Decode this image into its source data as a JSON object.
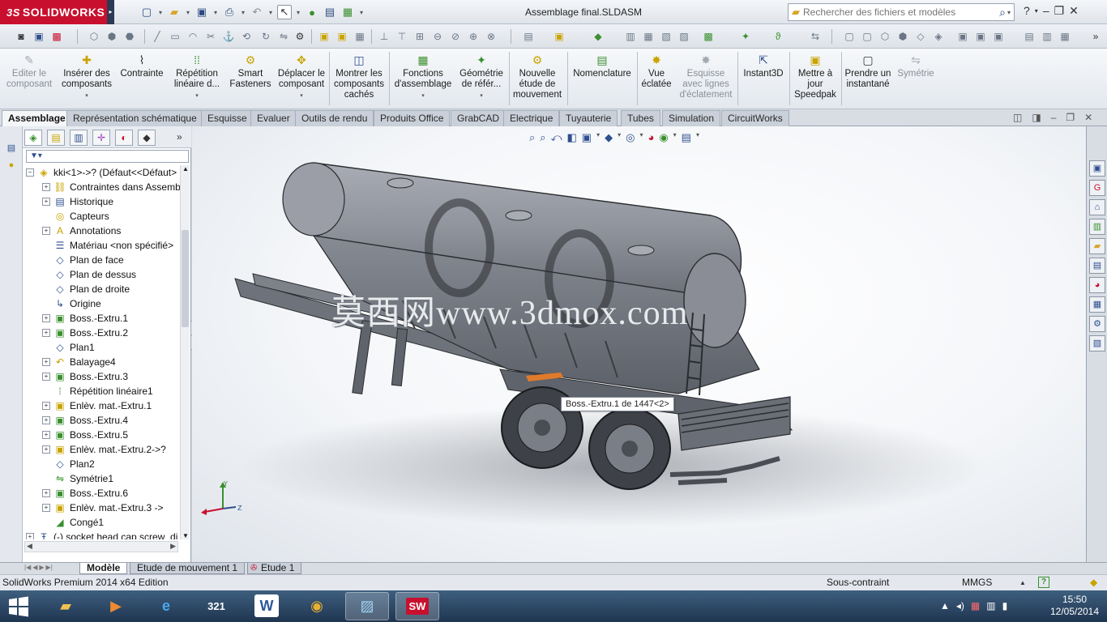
{
  "app": {
    "brand": "SOLIDWORKS",
    "brand_prefix": "3S",
    "document_title": "Assemblage final.SLDASM"
  },
  "search": {
    "placeholder": "Rechercher des fichiers et modèles"
  },
  "command_manager": [
    {
      "id": "edit-component",
      "label": "Editer le composant",
      "enabled": false,
      "icon": "edit-component-icon"
    },
    {
      "id": "insert-components",
      "label": "Insérer des composants",
      "enabled": true,
      "icon": "insert-components-icon"
    },
    {
      "id": "mate",
      "label": "Contrainte",
      "enabled": true,
      "icon": "paperclip-icon"
    },
    {
      "id": "linear-pattern",
      "label": "Répétition linéaire d...",
      "enabled": true,
      "icon": "linear-pattern-icon"
    },
    {
      "id": "smart-fasteners",
      "label": "Smart Fasteners",
      "enabled": true,
      "icon": "fastener-icon"
    },
    {
      "id": "move-component",
      "label": "Déplacer le composant",
      "enabled": true,
      "icon": "move-component-icon"
    },
    {
      "id": "show-hidden",
      "label": "Montrer les composants cachés",
      "enabled": true,
      "icon": "show-hidden-icon"
    },
    {
      "id": "assembly-features",
      "label": "Fonctions d'assemblage",
      "enabled": true,
      "icon": "assembly-features-icon"
    },
    {
      "id": "reference-geometry",
      "label": "Géométrie de référ...",
      "enabled": true,
      "icon": "reference-geometry-icon"
    },
    {
      "id": "new-motion-study",
      "label": "Nouvelle étude de mouvement",
      "enabled": true,
      "icon": "motion-study-icon"
    },
    {
      "id": "bom",
      "label": "Nomenclature",
      "enabled": true,
      "icon": "bom-icon"
    },
    {
      "id": "exploded-view",
      "label": "Vue éclatée",
      "enabled": true,
      "icon": "exploded-view-icon"
    },
    {
      "id": "explode-line-sketch",
      "label": "Esquisse avec lignes d'éclatement",
      "enabled": false,
      "icon": "explode-line-icon"
    },
    {
      "id": "instant3d",
      "label": "Instant3D",
      "enabled": true,
      "icon": "instant3d-icon"
    },
    {
      "id": "update-speedpak",
      "label": "Mettre à jour Speedpak",
      "enabled": true,
      "icon": "speedpak-icon"
    },
    {
      "id": "take-snapshot",
      "label": "Prendre un instantané",
      "enabled": true,
      "icon": "snapshot-icon"
    },
    {
      "id": "mirror",
      "label": "Symétrie",
      "enabled": false,
      "icon": "mirror-icon"
    }
  ],
  "tabs": [
    {
      "label": "Assemblage",
      "active": true
    },
    {
      "label": "Représentation schématique",
      "active": false
    },
    {
      "label": "Esquisse",
      "active": false
    },
    {
      "label": "Evaluer",
      "active": false
    },
    {
      "label": "Outils de rendu",
      "active": false
    },
    {
      "label": "Produits Office",
      "active": false
    },
    {
      "label": "GrabCAD",
      "active": false
    },
    {
      "label": "Electrique",
      "active": false
    },
    {
      "label": "Tuyauterie",
      "active": false
    },
    {
      "label": "Tubes",
      "active": false
    },
    {
      "label": "Simulation",
      "active": false
    },
    {
      "label": "CircuitWorks",
      "active": false
    }
  ],
  "feature_tree": {
    "root": "kki<1>->? (Défaut<<Défaut>",
    "items": [
      {
        "label": "Contraintes dans Assemb",
        "expandable": true,
        "icon": "mates-icon"
      },
      {
        "label": "Historique",
        "expandable": true,
        "icon": "history-icon"
      },
      {
        "label": "Capteurs",
        "expandable": false,
        "icon": "sensors-icon"
      },
      {
        "label": "Annotations",
        "expandable": true,
        "icon": "annotations-icon"
      },
      {
        "label": "Matériau <non spécifié>",
        "expandable": false,
        "icon": "material-icon"
      },
      {
        "label": "Plan de face",
        "expandable": false,
        "icon": "plane-icon"
      },
      {
        "label": "Plan de dessus",
        "expandable": false,
        "icon": "plane-icon"
      },
      {
        "label": "Plan de droite",
        "expandable": false,
        "icon": "plane-icon"
      },
      {
        "label": "Origine",
        "expandable": false,
        "icon": "origin-icon"
      },
      {
        "label": "Boss.-Extru.1",
        "expandable": true,
        "icon": "extrude-icon"
      },
      {
        "label": "Boss.-Extru.2",
        "expandable": true,
        "icon": "extrude-icon"
      },
      {
        "label": "Plan1",
        "expandable": false,
        "icon": "plane-icon"
      },
      {
        "label": "Balayage4",
        "expandable": true,
        "icon": "sweep-icon"
      },
      {
        "label": "Boss.-Extru.3",
        "expandable": true,
        "icon": "extrude-icon"
      },
      {
        "label": "Répétition linéaire1",
        "expandable": false,
        "icon": "linear-pattern-icon"
      },
      {
        "label": "Enlèv. mat.-Extru.1",
        "expandable": true,
        "icon": "cut-extrude-icon"
      },
      {
        "label": "Boss.-Extru.4",
        "expandable": true,
        "icon": "extrude-icon"
      },
      {
        "label": "Boss.-Extru.5",
        "expandable": true,
        "icon": "extrude-icon"
      },
      {
        "label": "Enlèv. mat.-Extru.2->?",
        "expandable": true,
        "icon": "cut-extrude-icon"
      },
      {
        "label": "Plan2",
        "expandable": false,
        "icon": "plane-icon"
      },
      {
        "label": "Symétrie1",
        "expandable": false,
        "icon": "mirror-icon"
      },
      {
        "label": "Boss.-Extru.6",
        "expandable": true,
        "icon": "extrude-icon"
      },
      {
        "label": "Enlèv. mat.-Extru.3 ->",
        "expandable": true,
        "icon": "cut-extrude-icon"
      },
      {
        "label": "Congé1",
        "expandable": false,
        "icon": "fillet-icon"
      },
      {
        "label": "(-) socket head cap screw_di",
        "expandable": true,
        "icon": "screw-icon"
      }
    ]
  },
  "viewport": {
    "watermark": "莫西网www.3dmox.com",
    "tooltip": "Boss.-Extru.1 de 1447<2>"
  },
  "bottom_tabs": [
    {
      "label": "Modèle",
      "active": true
    },
    {
      "label": "Etude de mouvement 1",
      "active": false
    },
    {
      "label": "Etude 1",
      "active": false
    }
  ],
  "status_bar": {
    "edition": "SolidWorks Premium 2014 x64 Edition",
    "state": "Sous-contraint",
    "units": "MMGS",
    "help": "?"
  },
  "taskbar": {
    "time": "15:50",
    "date": "12/05/2014"
  },
  "colors": {
    "brand_red": "#c8102e",
    "model_gray": "#8d9098",
    "selection_orange": "#e07a2a"
  }
}
